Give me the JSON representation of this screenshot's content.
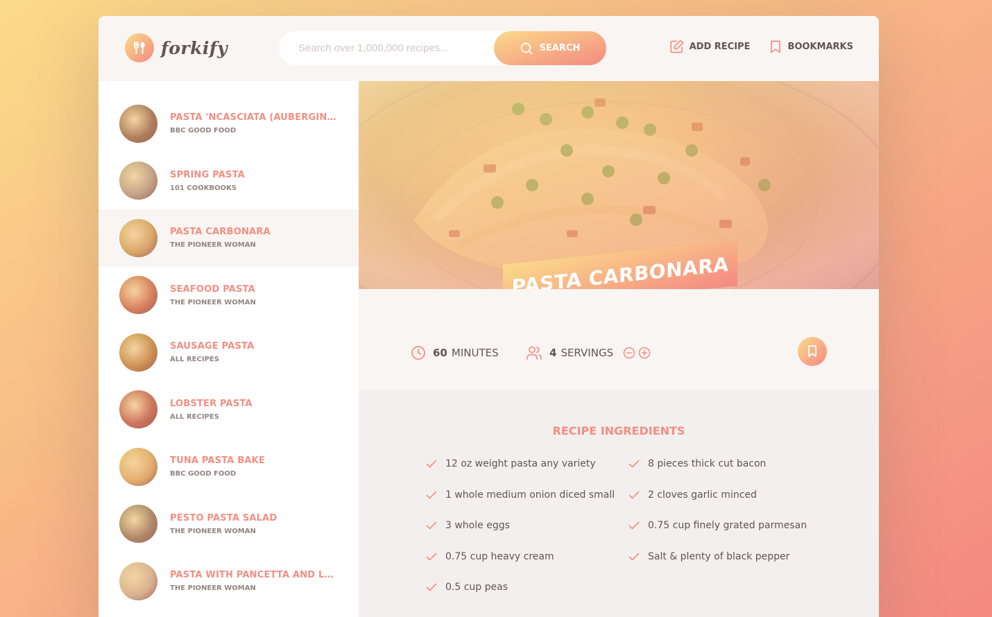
{
  "header": {
    "logo_text": "forkify",
    "search_placeholder": "Search over 1,000,000 recipes...",
    "search_label": "Search",
    "add_recipe_label": "Add recipe",
    "bookmarks_label": "Bookmarks"
  },
  "results": [
    {
      "title": "Pasta 'ncasciata (aubergine and pasta bake)",
      "publisher": "BBC Good Food",
      "color": "#8a6a4a"
    },
    {
      "title": "Spring Pasta",
      "publisher": "101 Cookbooks",
      "color": "#a8a08a"
    },
    {
      "title": "Pasta Carbonara",
      "publisher": "The Pioneer Woman",
      "color": "#c9a65a"
    },
    {
      "title": "Seafood Pasta",
      "publisher": "The Pioneer Woman",
      "color": "#c86a4a"
    },
    {
      "title": "Sausage Pasta",
      "publisher": "All Recipes",
      "color": "#b8843a"
    },
    {
      "title": "Lobster Pasta",
      "publisher": "All Recipes",
      "color": "#b85848"
    },
    {
      "title": "Tuna Pasta Bake",
      "publisher": "BBC Good Food",
      "color": "#d8b060"
    },
    {
      "title": "Pesto Pasta Salad",
      "publisher": "The Pioneer Woman",
      "color": "#8a7a5a"
    },
    {
      "title": "Pasta with Pancetta and Leeks",
      "publisher": "The Pioneer Woman",
      "color": "#c8b898"
    }
  ],
  "active_result_index": 2,
  "recipe": {
    "title": "Pasta Carbonara",
    "minutes": "60",
    "minutes_label": "minutes",
    "servings": "4",
    "servings_label": "servings",
    "ingredients_heading": "Recipe ingredients",
    "ingredients": [
      "12 oz weight pasta any variety",
      "8 pieces thick cut bacon",
      "1 whole medium onion diced small",
      "2 cloves garlic minced",
      "3 whole eggs",
      "0.75 cup finely grated parmesan",
      "0.75 cup heavy cream",
      " Salt & plenty of black pepper",
      "0.5 cup peas"
    ]
  },
  "colors": {
    "accent": "#f38e82",
    "gradient_start": "#fbdb89",
    "gradient_end": "#f48982",
    "text": "#615551"
  }
}
